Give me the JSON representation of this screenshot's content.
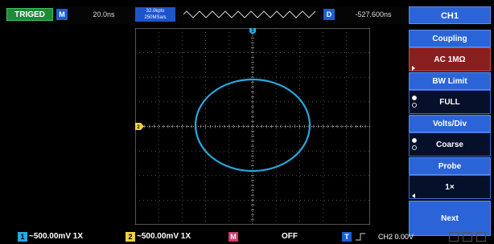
{
  "top": {
    "trig_status": "TRIGED",
    "mode_icon": "M",
    "timebase": "20.0ns",
    "memory_depth": "32.0kpts",
    "sample_rate": "250MSa/s",
    "delay_icon": "D",
    "trigger_offset": "-527.600ns"
  },
  "menu": {
    "title": "CH1",
    "items": [
      {
        "label": "Coupling",
        "value": "AC 1MΩ"
      },
      {
        "label": "BW Limit",
        "value": "FULL"
      },
      {
        "label": "Volts/Div",
        "value": "Coarse"
      },
      {
        "label": "Probe",
        "value": "1×"
      }
    ],
    "next": "Next"
  },
  "markers": {
    "ch1_marker": "1",
    "ch2_marker": "2"
  },
  "bottom": {
    "ch1_num": "1",
    "ch1_scale": "~500.00mV 1X",
    "ch2_num": "2",
    "ch2_scale": "~500.00mV 1X",
    "math_icon": "M",
    "math_state": "OFF",
    "trig_icon": "T",
    "trig_source": "CH2 0.00V"
  },
  "colors": {
    "ch1": "#28a9e0",
    "ch2": "#f0d23a",
    "menu_blue": "#2b64d6",
    "selected_red": "#8a1f1f",
    "trig_green": "#1f8a3a"
  }
}
